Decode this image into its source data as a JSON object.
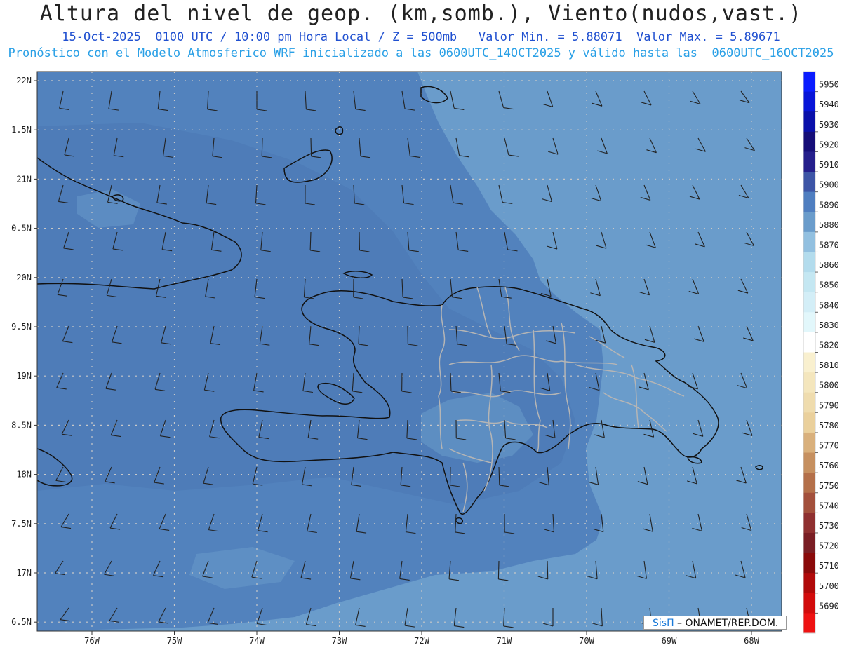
{
  "header": {
    "title": "Altura del nivel de geop. (km,somb.), Viento(nudos,vast.)",
    "subtitle_line1": "15-Oct-2025  0100 UTC / 10:00 pm Hora Local / Z = 500mb   Valor Min. = 5.88071  Valor Max. = 5.89671",
    "subtitle_line2": "Pronóstico con el Modelo Atmosferico WRF inicializado a las 0600UTC_14OCT2025 y válido hasta las  0600UTC_16OCT2025"
  },
  "map": {
    "lat_labels": [
      "22N",
      "1.5N",
      "21N",
      "0.5N",
      "20N",
      "9.5N",
      "19N",
      "8.5N",
      "18N",
      "7.5N",
      "17N",
      "6.5N"
    ],
    "lon_labels": [
      "76W",
      "75W",
      "74W",
      "73W",
      "72W",
      "71W",
      "70W",
      "69W",
      "68W"
    ],
    "colors": {
      "ocean_east": "#6a9ccb",
      "field_main": "#5282bd",
      "field_darker": "#4a78b5",
      "coast": "#111111",
      "borders": "#b5b5b5",
      "grid": "#c8c8c8"
    }
  },
  "colorbar": {
    "levels": [
      "5950",
      "5940",
      "5930",
      "5920",
      "5910",
      "5900",
      "5890",
      "5880",
      "5870",
      "5860",
      "5850",
      "5840",
      "5830",
      "5820",
      "5810",
      "5800",
      "5790",
      "5780",
      "5770",
      "5760",
      "5750",
      "5740",
      "5730",
      "5720",
      "5710",
      "5700",
      "5690"
    ],
    "colors": [
      "#0a1cff",
      "#0815d8",
      "#0a10aa",
      "#160e78",
      "#251f8c",
      "#3d55a6",
      "#4f7ec0",
      "#6a9ccb",
      "#92c0e0",
      "#b3dced",
      "#c4e7f2",
      "#d3eef7",
      "#e2f7fb",
      "#ffffff",
      "#f9f0cf",
      "#f4e6bd",
      "#efdcae",
      "#ead09c",
      "#d9b07c",
      "#c69060",
      "#b4704a",
      "#a3503c",
      "#8f3030",
      "#7a1e24",
      "#8a0a0a",
      "#b00a0a",
      "#d20c0c",
      "#ee1212"
    ]
  },
  "credit": {
    "brand": "SisΠ",
    "text": " – ONAMET/REP.DOM."
  }
}
